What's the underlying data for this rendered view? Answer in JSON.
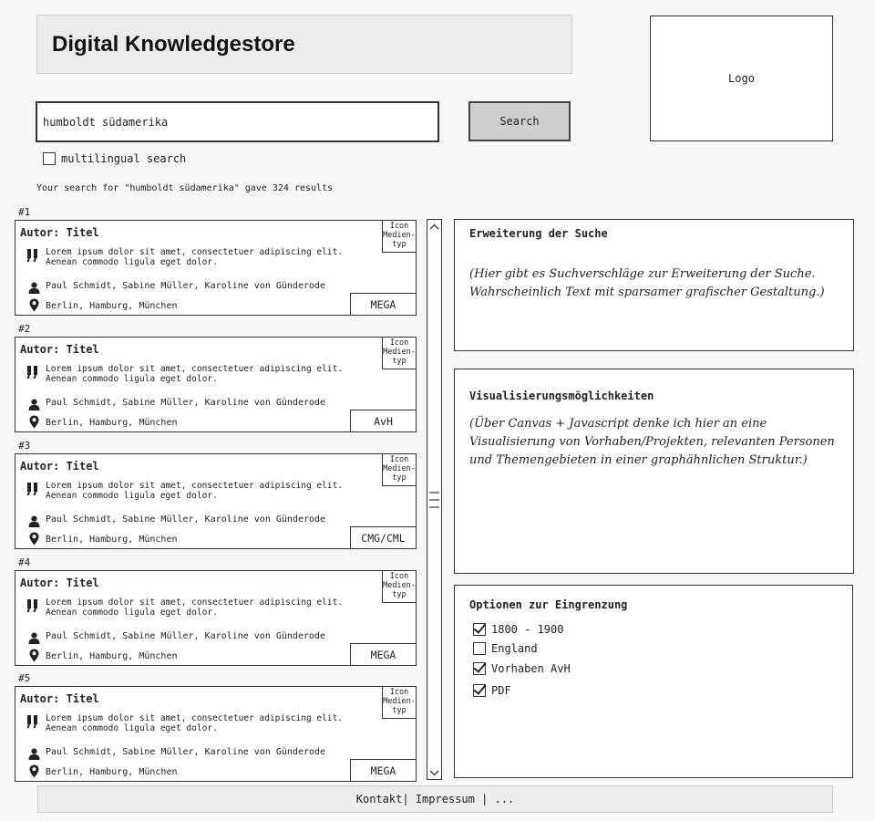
{
  "header": {
    "title": "Digital Knowledgestore"
  },
  "logo": {
    "label": "Logo"
  },
  "search": {
    "query": "humboldt südamerika",
    "button_label": "Search",
    "multilingual_label": "multilingual search",
    "multilingual_checked": false,
    "result_info": "Your search for \"humboldt südamerika\" gave 324 results"
  },
  "results": [
    {
      "number": "#1",
      "title": "Autor: Titel",
      "media_type": "Icon Medien-typ",
      "excerpt": "Lorem ipsum dolor sit amet, consectetuer adipiscing elit. Aenean commodo ligula eget dolor.",
      "persons": "Paul Schmidt, Sabine Müller, Karoline von Günderode",
      "places": "Berlin, Hamburg, München",
      "source": "MEGA"
    },
    {
      "number": "#2",
      "title": "Autor: Titel",
      "media_type": "Icon Medien-typ",
      "excerpt": "Lorem ipsum dolor sit amet, consectetuer adipiscing elit. Aenean commodo ligula eget dolor.",
      "persons": "Paul Schmidt, Sabine Müller, Karoline von Günderode",
      "places": "Berlin, Hamburg, München",
      "source": "AvH"
    },
    {
      "number": "#3",
      "title": "Autor: Titel",
      "media_type": "Icon Medien-typ",
      "excerpt": "Lorem ipsum dolor sit amet, consectetuer adipiscing elit. Aenean commodo ligula eget dolor.",
      "persons": "Paul Schmidt, Sabine Müller, Karoline von Günderode",
      "places": "Berlin, Hamburg, München",
      "source": "CMG/CML"
    },
    {
      "number": "#4",
      "title": "Autor: Titel",
      "media_type": "Icon Medien-typ",
      "excerpt": "Lorem ipsum dolor sit amet, consectetuer adipiscing elit. Aenean commodo ligula eget dolor.",
      "persons": "Paul Schmidt, Sabine Müller, Karoline von Günderode",
      "places": "Berlin, Hamburg, München",
      "source": "MEGA"
    },
    {
      "number": "#5",
      "title": "Autor: Titel",
      "media_type": "Icon Medien-typ",
      "excerpt": "Lorem ipsum dolor sit amet, consectetuer adipiscing elit. Aenean commodo ligula eget dolor.",
      "persons": "Paul Schmidt, Sabine Müller, Karoline von Günderode",
      "places": "Berlin, Hamburg, München",
      "source": "MEGA"
    }
  ],
  "panels": {
    "extension": {
      "title": "Erweiterung der Suche",
      "text": "(Hier gibt es Suchverschläge zur Erweiterung der Suche. Wahrscheinlich Text mit sparsamer grafischer Gestaltung.)"
    },
    "visualization": {
      "title": "Visualisierungsmöglichkeiten",
      "text": "(Über Canvas + Javascript denke ich hier an eine Visualisierung von Vorhaben/Projekten, relevanten Personen und Themengebieten in einer graphähnlichen Struktur.)"
    },
    "filters": {
      "title": "Optionen zur Eingrenzung",
      "options": [
        {
          "label": "1800 - 1900",
          "checked": true
        },
        {
          "label": "England",
          "checked": false
        },
        {
          "label": "Vorhaben AvH",
          "checked": true
        },
        {
          "label": "PDF",
          "checked": true
        }
      ]
    }
  },
  "footer": {
    "kontakt": "Kontakt",
    "sep1": "| ",
    "impressum": "Impressum",
    "sep2": " | ",
    "more": "..."
  },
  "icons": {
    "quote": "quote-icon",
    "person": "person-icon",
    "location": "location-pin-icon",
    "scroll_up": "chevron-up-icon",
    "scroll_down": "chevron-down-icon",
    "thumb": "scroll-grip-icon"
  }
}
